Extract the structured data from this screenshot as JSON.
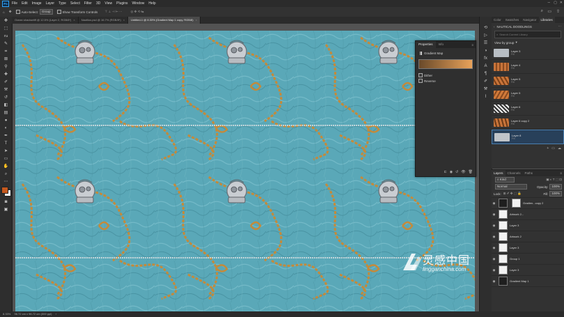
{
  "menubar": {
    "app_icon": "Ps",
    "items": [
      "File",
      "Edit",
      "Image",
      "Layer",
      "Type",
      "Select",
      "Filter",
      "3D",
      "View",
      "Plugins",
      "Window",
      "Help"
    ]
  },
  "options_bar": {
    "auto_select_label": "Auto-Select:",
    "auto_select_value": "Group",
    "show_transform_label": "Show Transform Controls"
  },
  "tabs": [
    {
      "label": "Ocean shadowtiff @ 12.5% (Layer 2, RGB/8*)",
      "active": false
    },
    {
      "label": "Nautilus.psd @ 16.7% (RGB/8*)",
      "active": false
    },
    {
      "label": "Untitled-1 @ 8.33% (Gradient Map 1 copy, RGB/8)",
      "active": true
    }
  ],
  "status": {
    "zoom": "8.33%",
    "doc": "96.72 cm x 96.72 cm (300 ppi)"
  },
  "properties": {
    "tab_properties": "Properties",
    "tab_info": "Info",
    "adjustment": "Gradient Map",
    "dither": "Dither",
    "reverse": "Reverse",
    "gradient_start": "#6a4a2a",
    "gradient_end": "#e8a25a"
  },
  "libraries": {
    "tabs": [
      "Color",
      "Swatches",
      "Navigator",
      "Libraries"
    ],
    "library_name": "NAUTICAL DOODLINGS",
    "search_placeholder": "Search Current Library",
    "view_by": "View by group",
    "items": [
      {
        "name": "Layer 3",
        "sub": "Fill"
      },
      {
        "name": "Layer 4",
        "sub": "Fill"
      },
      {
        "name": "Layer 5",
        "sub": "Fill"
      },
      {
        "name": "Layer 5",
        "sub": "Fill"
      },
      {
        "name": "Layer 6",
        "sub": "Fill"
      },
      {
        "name": "Layer 6 copy 2",
        "sub": "Fill"
      },
      {
        "name": "Layer 8",
        "sub": "Fill"
      }
    ]
  },
  "layers": {
    "tabs": [
      "Layers",
      "Channels",
      "Paths"
    ],
    "kind": "Kind",
    "blend": "Normal",
    "opacity_label": "Opacity:",
    "opacity": "100%",
    "lock_label": "Lock:",
    "fill_label": "Fill:",
    "fill": "100%",
    "rows": [
      {
        "name": "Gradien...copy 2"
      },
      {
        "name": "Artwork 2..."
      },
      {
        "name": "Layer 3"
      },
      {
        "name": "Artwork 2"
      },
      {
        "name": "Layer 3"
      },
      {
        "name": "Group 1"
      },
      {
        "name": "Layer 3"
      },
      {
        "name": "Gradient Map 1"
      }
    ]
  },
  "watermark": {
    "brand": "灵感中国",
    "url": "lingganchina.com"
  },
  "colors": {
    "foreground": "#c4581e",
    "background": "#ffffff",
    "canvas": "#5aa8b8",
    "rope": "#c48a3a"
  }
}
